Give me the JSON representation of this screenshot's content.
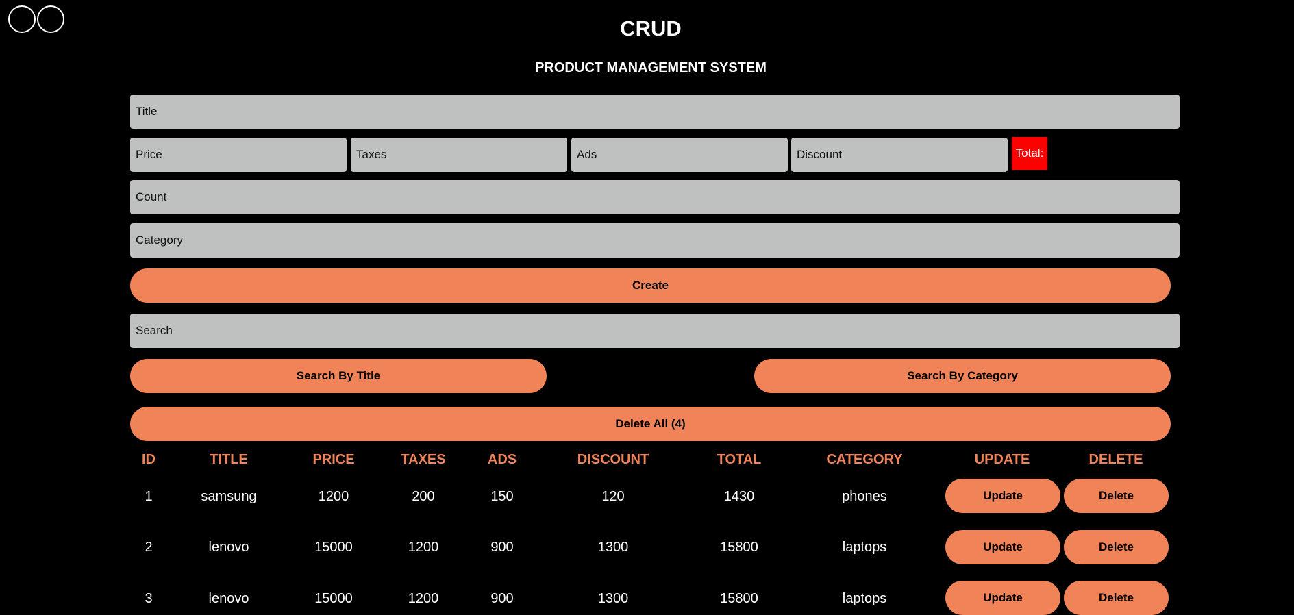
{
  "header": {
    "title": "CRUD",
    "subtitle": "PRODUCT MANAGEMENT SYSTEM"
  },
  "form": {
    "title_placeholder": "Title",
    "price_placeholder": "Price",
    "taxes_placeholder": "Taxes",
    "ads_placeholder": "Ads",
    "discount_placeholder": "Discount",
    "total_label": "Total:",
    "count_placeholder": "Count",
    "category_placeholder": "Category",
    "create_label": "Create"
  },
  "search": {
    "placeholder": "Search",
    "by_title_label": "Search By Title",
    "by_category_label": "Search By Category",
    "delete_all_label": "Delete All (4)"
  },
  "table": {
    "headers": [
      "ID",
      "TITLE",
      "PRICE",
      "TAXES",
      "ADS",
      "DISCOUNT",
      "TOTAL",
      "CATEGORY",
      "UPDATE",
      "DELETE"
    ],
    "rows": [
      {
        "id": "1",
        "title": "samsung",
        "price": "1200",
        "taxes": "200",
        "ads": "150",
        "discount": "120",
        "total": "1430",
        "category": "phones",
        "update": "Update",
        "delete": "Delete"
      },
      {
        "id": "2",
        "title": "lenovo",
        "price": "15000",
        "taxes": "1200",
        "ads": "900",
        "discount": "1300",
        "total": "15800",
        "category": "laptops",
        "update": "Update",
        "delete": "Delete"
      },
      {
        "id": "3",
        "title": "lenovo",
        "price": "15000",
        "taxes": "1200",
        "ads": "900",
        "discount": "1300",
        "total": "15800",
        "category": "laptops",
        "update": "Update",
        "delete": "Delete"
      }
    ]
  },
  "colors": {
    "background": "#000000",
    "accent": "#f08357",
    "input_bg": "#bfc1c0",
    "total_bg": "#ff0000"
  }
}
